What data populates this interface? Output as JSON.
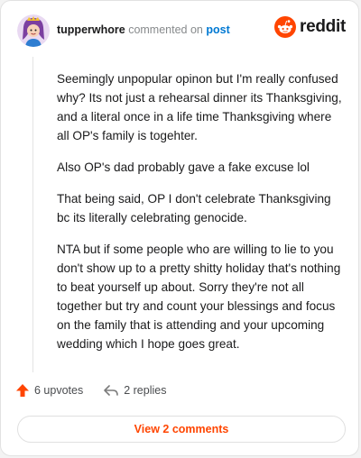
{
  "comment": {
    "username": "tupperwhore",
    "action_text": "commented on",
    "target_link": "post",
    "paragraphs": [
      "Seemingly unpopular opinon but I'm really confused why? Its not just a rehearsal dinner its Thanksgiving, and a literal once in a life time Thanksgiving where all OP's family is togehter.",
      "Also OP's dad probably gave a fake excuse lol",
      "That being said, OP I don't celebrate Thanksgiving bc its literally celebrating genocide.",
      "NTA but if some people who are willing to lie to you don't show up to a pretty shitty holiday that's nothing to beat yourself up about. Sorry they're not all together but try and count your blessings and focus on the family that is attending and your upcoming wedding which I hope goes great."
    ]
  },
  "brand": {
    "logo_text": "reddit",
    "accent_color": "#ff4500"
  },
  "actions": {
    "upvotes_label": "6 upvotes",
    "replies_label": "2 replies",
    "upvote_icon": "upvote-arrow-icon",
    "reply_icon": "reply-arrow-icon"
  },
  "footer": {
    "view_comments_label": "View 2 comments"
  }
}
